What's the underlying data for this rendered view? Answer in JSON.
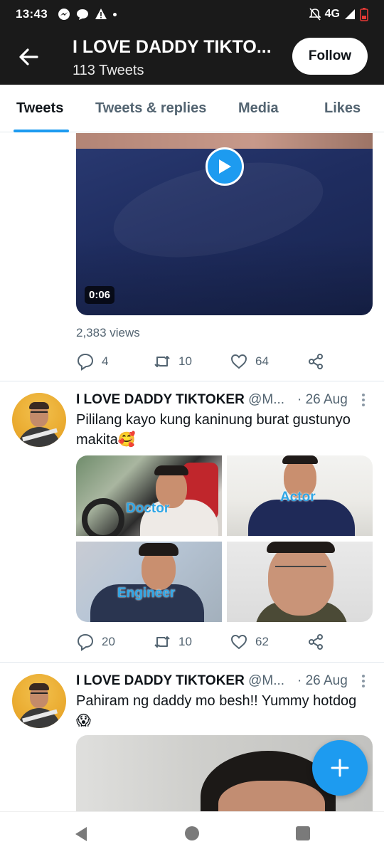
{
  "status_bar": {
    "time": "13:43",
    "network": "4G",
    "icons": [
      "messenger-icon",
      "chat-bubble-icon",
      "alert-icon",
      "dot-icon",
      "mute-icon",
      "signal-icon",
      "battery-icon"
    ]
  },
  "header": {
    "title": "I LOVE DADDY TIKTO...",
    "subtitle": "113 Tweets",
    "follow_label": "Follow",
    "back_icon": "arrow-left-icon"
  },
  "tabs": [
    {
      "label": "Tweets",
      "active": true
    },
    {
      "label": "Tweets & replies",
      "active": false
    },
    {
      "label": "Media",
      "active": false
    },
    {
      "label": "Likes",
      "active": false
    }
  ],
  "tweet_prev": {
    "video_duration": "0:06",
    "views": "2,383 views",
    "replies": "4",
    "retweets": "10",
    "likes": "64"
  },
  "tweet_1": {
    "display_name": "I LOVE DADDY TIKTOKER",
    "handle": "@M...",
    "date": "· 26 Aug",
    "text": "Pililang  kayo kung kaninung burat gustunyo makita🥰",
    "image_labels": [
      "Doctor",
      "Actor",
      "Engineer",
      ""
    ],
    "replies": "20",
    "retweets": "10",
    "likes": "62"
  },
  "tweet_2": {
    "display_name": "I LOVE DADDY TIKTOKER",
    "handle": "@M...",
    "date": "· 26 Aug",
    "text": "Pahiram ng daddy mo besh!! Yummy hotdog 😱"
  },
  "colors": {
    "accent": "#1d9bf0",
    "header_bg": "#1a1a1a",
    "secondary_text": "#536471"
  }
}
